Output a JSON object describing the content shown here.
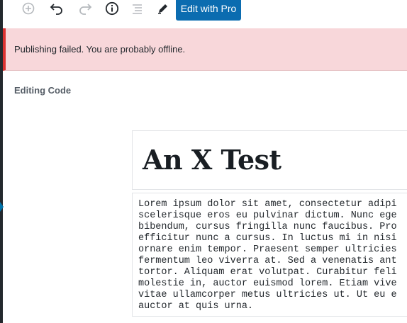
{
  "toolbar": {
    "icons": [
      "add-block-icon",
      "undo-icon",
      "redo-icon",
      "info-icon",
      "list-view-icon",
      "edit-pencil-icon"
    ],
    "edit_pro_label": "Edit with Pro"
  },
  "notice": {
    "message": "Publishing failed. You are probably offline."
  },
  "editor": {
    "section_title": "Editing Code",
    "post_title": "An X Test",
    "code_lines": [
      "Lorem ipsum dolor sit amet, consectetur adipi",
      "scelerisque eros eu pulvinar dictum. Nunc ege",
      "bibendum, cursus fringilla nunc faucibus. Pro",
      "efficitur nunc a cursus. In luctus mi in nisi",
      "ornare enim tempor. Praesent semper ultricies",
      "fermentum leo viverra at. Sed a venenatis ant",
      "tortor. Aliquam erat volutpat. Curabitur feli",
      "molestie in, auctor euismod lorem. Etiam vive",
      "vitae ullamcorper metus ultricies ut. Ut eu e",
      "auctor at quis urna."
    ]
  },
  "colors": {
    "accent": "#0b6cb0",
    "notice_bg": "#f8d7da",
    "notice_border": "#dc3232"
  }
}
